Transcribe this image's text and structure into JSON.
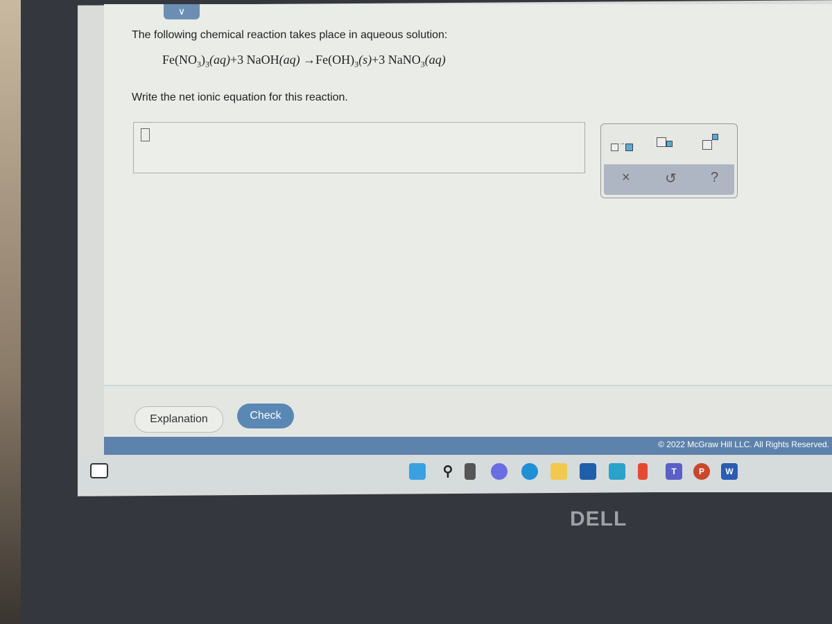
{
  "question": {
    "intro": "The following chemical reaction takes place in aqueous solution:",
    "equation": {
      "reactant1": "Fe(NO",
      "r1_sub": "3",
      "r1_close": ")",
      "r1_sub2": "3",
      "r1_state": "(aq)",
      "plus1": "+3 NaOH",
      "r2_state": "(aq)",
      "arrow": " →",
      "product1": "Fe(OH)",
      "p1_sub": "3",
      "p1_state": "(s)",
      "plus2": "+3 NaNO",
      "p2_sub": "3",
      "p2_state": "(aq)"
    },
    "prompt": "Write the net ionic equation for this reaction."
  },
  "answer_input": {
    "value": ""
  },
  "tools": {
    "top": [
      "reaction-arrow",
      "subscript",
      "superscript"
    ],
    "clear": "×",
    "undo": "↺",
    "help": "?"
  },
  "buttons": {
    "explanation": "Explanation",
    "check": "Check"
  },
  "footer": {
    "copyright": "© 2022 McGraw Hill LLC. All Rights Reserved."
  },
  "taskbar": {
    "icons": [
      "start",
      "search",
      "task-view",
      "chat",
      "edge",
      "file-explorer",
      "store",
      "mail",
      "office",
      "teams",
      "powerpoint",
      "word"
    ],
    "labels": {
      "teams": "T",
      "powerpoint": "P",
      "word": "W"
    }
  },
  "brand": "DELL",
  "colors": {
    "accent": "#5a88b5",
    "footer": "#5d82ab"
  }
}
